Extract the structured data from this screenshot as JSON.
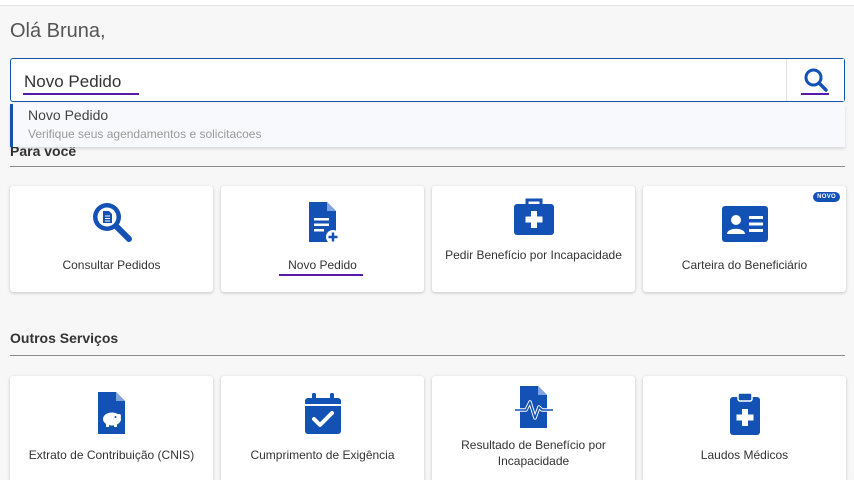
{
  "greeting": "Olá Bruna,",
  "search": {
    "value": "Novo Pedido",
    "button_icon": "search-icon"
  },
  "suggestion": {
    "title": "Novo Pedido",
    "subtitle": "Verifique seus agendamentos e solicitacoes"
  },
  "sections": {
    "for_you": "Para você",
    "other": "Outros Serviços"
  },
  "cards_for_you": [
    {
      "label": "Consultar Pedidos",
      "icon": "search-document-icon"
    },
    {
      "label": "Novo Pedido",
      "icon": "new-document-icon"
    },
    {
      "label": "Pedir Benefício por Incapacidade",
      "icon": "medical-kit-icon"
    },
    {
      "label": "Carteira do Beneficiário",
      "icon": "id-card-icon",
      "badge": "NOVO"
    }
  ],
  "cards_other": [
    {
      "label": "Extrato de Contribuição (CNIS)",
      "icon": "piggy-document-icon"
    },
    {
      "label": "Cumprimento de Exigência",
      "icon": "calendar-check-icon"
    },
    {
      "label": "Resultado de Benefício por Incapacidade",
      "icon": "heartbeat-document-icon"
    },
    {
      "label": "Laudos Médicos",
      "icon": "medical-clipboard-icon"
    }
  ],
  "colors": {
    "primary": "#1351b4",
    "focus": "#5a1aa8"
  }
}
